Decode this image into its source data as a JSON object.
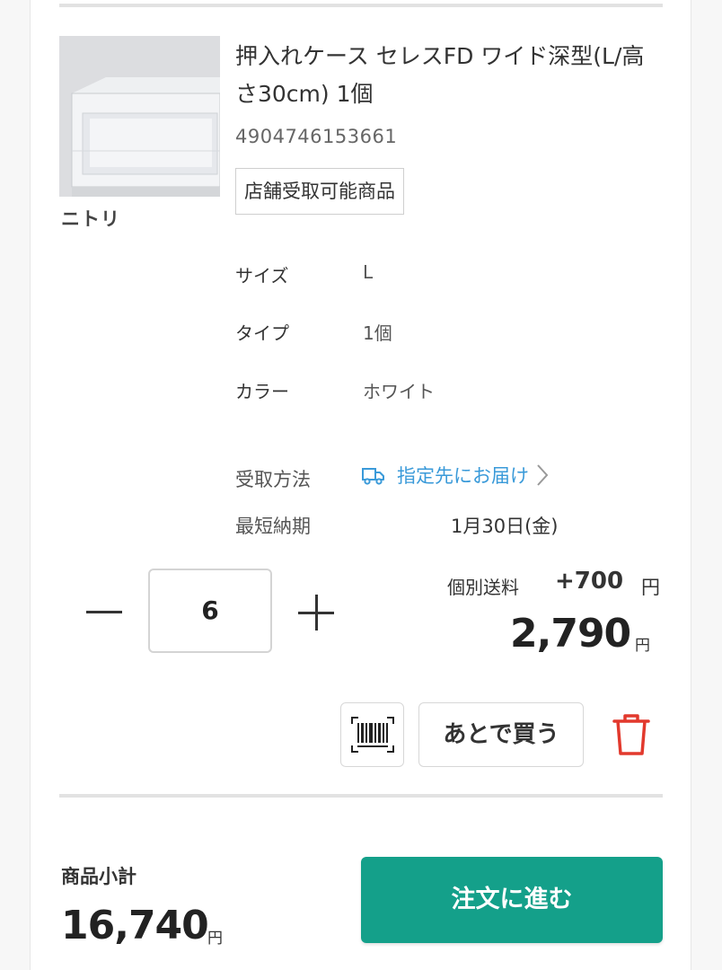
{
  "product": {
    "title": "押入れケース セレスFD ワイド深型(L/高さ30cm) 1個",
    "jan_code": "4904746153661",
    "badge": "店舗受取可能商品",
    "brand": "ニトリ",
    "image_icon": "storage-drawer-image"
  },
  "specs": [
    {
      "key": "サイズ",
      "value": "L"
    },
    {
      "key": "タイプ",
      "value": "1個"
    },
    {
      "key": "カラー",
      "value": "ホワイト"
    }
  ],
  "delivery": {
    "method_label": "受取方法",
    "method_value": "指定先にお届け",
    "method_icon": "truck-icon",
    "shortest_label": "最短納期",
    "shortest_value": "1月30日(金)"
  },
  "quantity": {
    "value": "6",
    "minus_icon": "minus-icon",
    "plus_icon": "plus-icon"
  },
  "pricing": {
    "shipping_label": "個別送料",
    "shipping_amount": "+700",
    "shipping_currency": "円",
    "price": "2,790",
    "price_currency": "円"
  },
  "actions": {
    "barcode_icon": "barcode-icon",
    "save_later_label": "あとで買う",
    "trash_icon": "trash-icon"
  },
  "summary": {
    "subtotal_label": "商品小計",
    "subtotal_amount": "16,740",
    "subtotal_currency": "円",
    "order_button": "注文に進む"
  },
  "colors": {
    "accent_green": "#14a08a",
    "link_blue": "#3a9ad9",
    "trash_red": "#e2392d"
  }
}
